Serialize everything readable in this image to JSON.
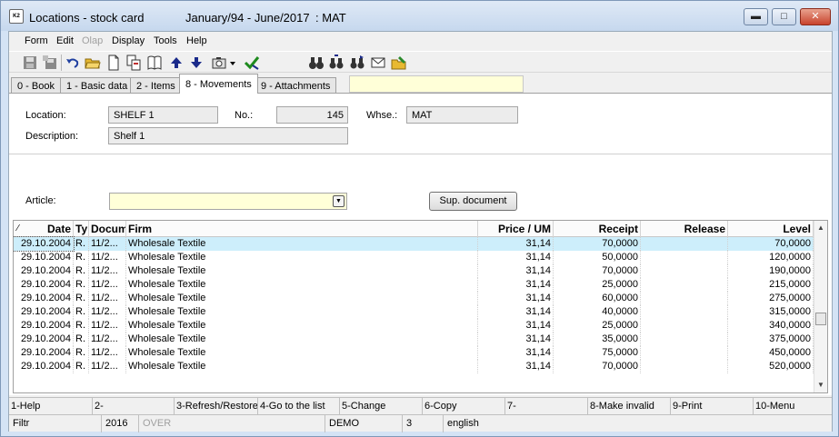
{
  "window": {
    "title": "Locations - stock card",
    "period": "January/94    - June/2017",
    "context": ": MAT"
  },
  "menu": [
    "Form",
    "Edit",
    "Olap",
    "Display",
    "Tools",
    "Help"
  ],
  "menu_disabled": [
    "Olap"
  ],
  "toolbar_icons": [
    "save-icon",
    "save-all-icon",
    "undo-icon",
    "open-folder-icon",
    "new-document-icon",
    "copy-documents-icon",
    "book-icon",
    "arrow-up-icon",
    "arrow-down-icon",
    "camera-icon",
    "dropdown-arrow-icon",
    "confirm-icon",
    "binoculars-icon",
    "binoculars-find-icon",
    "binoculars-next-icon",
    "envelope-icon",
    "edit-folder-icon"
  ],
  "tabs": [
    "0 - Book",
    "1 - Basic data",
    "2 - Items",
    "8 - Movements",
    "9 - Attachments"
  ],
  "active_tab": "8 - Movements",
  "form": {
    "location_label": "Location:",
    "location_value": "SHELF 1",
    "no_label": "No.:",
    "no_value": "145",
    "whse_label": "Whse.:",
    "whse_value": "MAT",
    "description_label": "Description:",
    "description_value": "Shelf 1",
    "article_label": "Article:",
    "article_value": "",
    "sup_document_button": "Sup. document"
  },
  "grid": {
    "sort_indicator": "⁄",
    "columns": [
      "Date",
      "Ty",
      "Docum",
      "Firm",
      "Price / UM",
      "Receipt",
      "Release",
      "Level"
    ],
    "rows": [
      [
        "29.10.2004",
        "R.",
        "11/2...",
        "Wholesale Textile",
        "31,14",
        "70,0000",
        "",
        "70,0000"
      ],
      [
        "29.10.2004",
        "R.",
        "11/2...",
        "Wholesale Textile",
        "31,14",
        "50,0000",
        "",
        "120,0000"
      ],
      [
        "29.10.2004",
        "R.",
        "11/2...",
        "Wholesale Textile",
        "31,14",
        "70,0000",
        "",
        "190,0000"
      ],
      [
        "29.10.2004",
        "R.",
        "11/2...",
        "Wholesale Textile",
        "31,14",
        "25,0000",
        "",
        "215,0000"
      ],
      [
        "29.10.2004",
        "R.",
        "11/2...",
        "Wholesale Textile",
        "31,14",
        "60,0000",
        "",
        "275,0000"
      ],
      [
        "29.10.2004",
        "R.",
        "11/2...",
        "Wholesale Textile",
        "31,14",
        "40,0000",
        "",
        "315,0000"
      ],
      [
        "29.10.2004",
        "R.",
        "11/2...",
        "Wholesale Textile",
        "31,14",
        "25,0000",
        "",
        "340,0000"
      ],
      [
        "29.10.2004",
        "R.",
        "11/2...",
        "Wholesale Textile",
        "31,14",
        "35,0000",
        "",
        "375,0000"
      ],
      [
        "29.10.2004",
        "R.",
        "11/2...",
        "Wholesale Textile",
        "31,14",
        "75,0000",
        "",
        "450,0000"
      ],
      [
        "29.10.2004",
        "R.",
        "11/2...",
        "Wholesale Textile",
        "31,14",
        "70,0000",
        "",
        "520,0000"
      ]
    ]
  },
  "function_keys": [
    "1-Help",
    "2-",
    "3-Refresh/Restore",
    "4-Go to the list",
    "5-Change",
    "6-Copy",
    "7-",
    "8-Make invalid",
    "9-Print",
    "10-Menu"
  ],
  "status_bar": [
    "Filtr",
    "2016",
    "OVER",
    "DEMO",
    "3",
    "english"
  ],
  "colors": {
    "selected_row": "#cdeefb",
    "filter_field": "#ffffd8",
    "title_bar": "#d4e3f5",
    "close_button": "#c8432c"
  }
}
